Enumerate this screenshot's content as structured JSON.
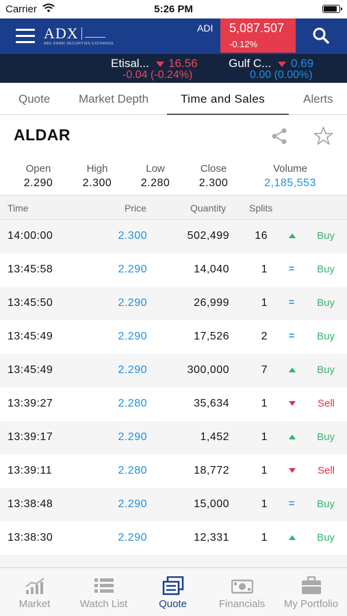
{
  "status_bar": {
    "carrier": "Carrier",
    "time": "5:26 PM"
  },
  "header": {
    "index_label": "ADI",
    "index_value": "5,087.507",
    "index_change": "-0.12%",
    "colors": {
      "header_bg": "#1a3e8c",
      "index_box": "#e53b4a"
    },
    "icons": [
      "menu-icon",
      "adx-logo",
      "search-icon"
    ]
  },
  "ticker": [
    {
      "name": "Etisal...",
      "price": "16.56",
      "delta": "-0.04 (-0.24%)",
      "direction": "down"
    },
    {
      "name": "Gulf C...",
      "price": "0.69",
      "delta": "0.00 (0.00%)",
      "direction": "down"
    }
  ],
  "tabs": [
    {
      "label": "Quote",
      "active": false
    },
    {
      "label": "Market Depth",
      "active": false
    },
    {
      "label": "Time and Sales",
      "active": true
    },
    {
      "label": "Alerts",
      "active": false
    }
  ],
  "stock": {
    "symbol": "ALDAR"
  },
  "summary": {
    "open_label": "Open",
    "open": "2.290",
    "high_label": "High",
    "high": "2.300",
    "low_label": "Low",
    "low": "2.280",
    "close_label": "Close",
    "close": "2.300",
    "volume_label": "Volume",
    "volume": "2,185,553"
  },
  "table": {
    "columns": {
      "time": "Time",
      "price": "Price",
      "quantity": "Quantity",
      "splits": "Splits"
    },
    "rows": [
      {
        "time": "14:00:00",
        "price": "2.300",
        "quantity": "502,499",
        "splits": "16",
        "indicator": "up",
        "side": "Buy"
      },
      {
        "time": "13:45:58",
        "price": "2.290",
        "quantity": "14,040",
        "splits": "1",
        "indicator": "equal",
        "side": "Buy"
      },
      {
        "time": "13:45:50",
        "price": "2.290",
        "quantity": "26,999",
        "splits": "1",
        "indicator": "equal",
        "side": "Buy"
      },
      {
        "time": "13:45:49",
        "price": "2.290",
        "quantity": "17,526",
        "splits": "2",
        "indicator": "equal",
        "side": "Buy"
      },
      {
        "time": "13:45:49",
        "price": "2.290",
        "quantity": "300,000",
        "splits": "7",
        "indicator": "up",
        "side": "Buy"
      },
      {
        "time": "13:39:27",
        "price": "2.280",
        "quantity": "35,634",
        "splits": "1",
        "indicator": "down",
        "side": "Sell"
      },
      {
        "time": "13:39:17",
        "price": "2.290",
        "quantity": "1,452",
        "splits": "1",
        "indicator": "up",
        "side": "Buy"
      },
      {
        "time": "13:39:11",
        "price": "2.280",
        "quantity": "18,772",
        "splits": "1",
        "indicator": "down",
        "side": "Sell"
      },
      {
        "time": "13:38:48",
        "price": "2.290",
        "quantity": "15,000",
        "splits": "1",
        "indicator": "equal",
        "side": "Buy"
      },
      {
        "time": "13:38:30",
        "price": "2.290",
        "quantity": "12,331",
        "splits": "1",
        "indicator": "up",
        "side": "Buy"
      },
      {
        "time": "",
        "price": "",
        "quantity": "",
        "splits": "",
        "indicator": "",
        "side": ""
      }
    ],
    "equal_glyph": "="
  },
  "tabbar": [
    {
      "label": "Market",
      "icon": "market-chart-icon",
      "active": false
    },
    {
      "label": "Watch List",
      "icon": "watch-list-icon",
      "active": false
    },
    {
      "label": "Quote",
      "icon": "quote-icon",
      "active": true
    },
    {
      "label": "Financials",
      "icon": "financials-icon",
      "active": false
    },
    {
      "label": "My Portfolio",
      "icon": "portfolio-icon",
      "active": false
    }
  ]
}
